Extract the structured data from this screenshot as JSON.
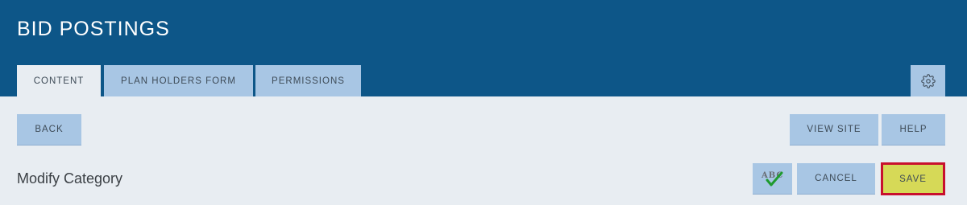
{
  "header": {
    "title": "BID POSTINGS"
  },
  "tabs": [
    {
      "label": "CONTENT",
      "active": true
    },
    {
      "label": "PLAN HOLDERS FORM",
      "active": false
    },
    {
      "label": "PERMISSIONS",
      "active": false
    }
  ],
  "settings": {
    "icon": "gear-icon"
  },
  "toolbar": {
    "back_label": "BACK",
    "view_site_label": "VIEW SITE",
    "help_label": "HELP"
  },
  "form": {
    "heading": "Modify Category",
    "spellcheck_icon": "spellcheck-icon",
    "spellcheck_text": "ABC",
    "cancel_label": "CANCEL",
    "save_label": "SAVE"
  },
  "colors": {
    "header_bg": "#0d5688",
    "tab_bg": "#a8c6e4",
    "page_bg": "#e8edf2",
    "save_bg": "#d6d957",
    "save_border": "#c8102e"
  }
}
